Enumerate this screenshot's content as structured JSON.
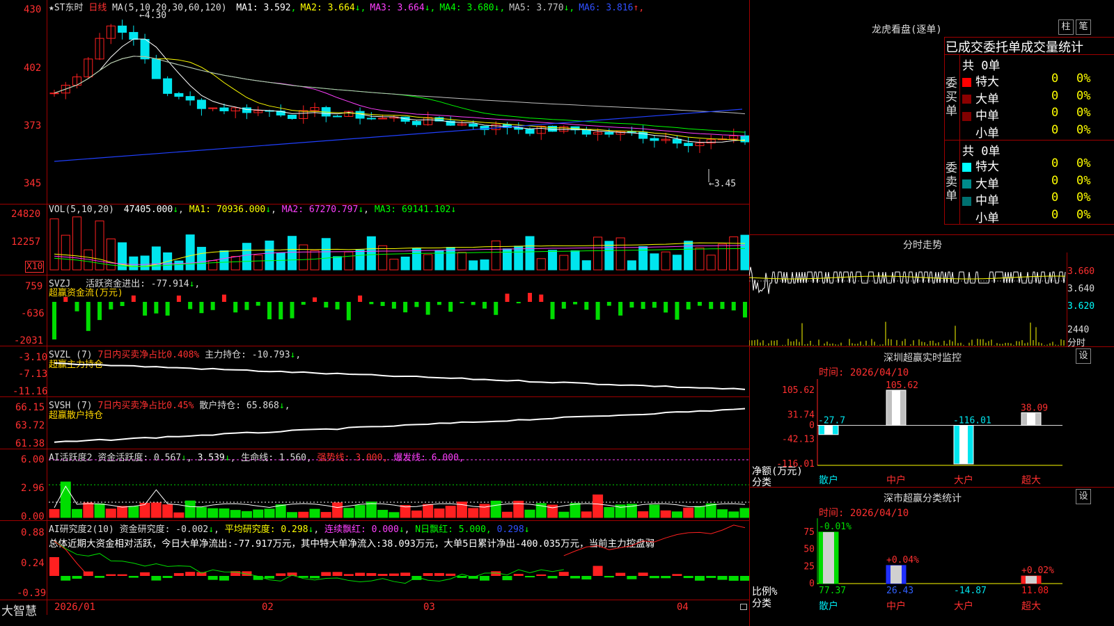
{
  "colors": {
    "up": "#ff2020",
    "down": "#00e5ee",
    "grid": "#a00000",
    "bg": "#000000"
  },
  "kline": {
    "stock_name": "★ST东时",
    "period": "日线",
    "ma_params": "MA(5,10,20,30,60,120)",
    "ma": [
      {
        "label": "MA1:",
        "value": "3.592",
        "arrow": "",
        "color": "#ffffff"
      },
      {
        "label": "MA2:",
        "value": "3.664",
        "arrow": "↓",
        "color": "#ffff00"
      },
      {
        "label": "MA3:",
        "value": "3.664",
        "arrow": "↓",
        "color": "#ff40ff"
      },
      {
        "label": "MA4:",
        "value": "3.680",
        "arrow": "↓",
        "color": "#00ff00"
      },
      {
        "label": "MA5:",
        "value": "3.770",
        "arrow": "↓",
        "color": "#c0c0c0"
      },
      {
        "label": "MA6:",
        "value": "3.816",
        "arrow": "↑",
        "color": "#3050ff"
      }
    ],
    "axis": [
      "430",
      "402",
      "373",
      "345"
    ],
    "high_mark": "4.30",
    "low_mark": "3.45"
  },
  "vol": {
    "title": "VOL(5,10,20)",
    "value": "47405.000",
    "arrow": "↓",
    "ma1": "MA1: 70936.000",
    "ma1_arrow": "↓",
    "ma2": "MA2: 67270.797",
    "ma2_arrow": "↓",
    "ma3": "MA3: 69141.102",
    "ma3_arrow": "↓",
    "axis": [
      "24820",
      "12257"
    ],
    "unit": "X10"
  },
  "svzj": {
    "title": "SVZJ",
    "label": "活跃资金进出: -77.914",
    "arrow": "↓",
    "sub": "超赢资金流(万元)",
    "axis": [
      "759",
      "-636",
      "-2031"
    ]
  },
  "svzl": {
    "title": "SVZL (7)",
    "red": "7日内买卖净占比0.408%",
    "label": "主力持仓: -10.793",
    "arrow": "↓",
    "sub": "超赢主力持仓",
    "axis": [
      "-3.10",
      "-7.13",
      "-11.16"
    ]
  },
  "svsh": {
    "title": "SVSH (7)",
    "red": "7日内买卖净占比0.45%",
    "label": "散户持仓: 65.868",
    "arrow": "↓",
    "sub": "超赢散户持仓",
    "axis": [
      "66.15",
      "63.72",
      "61.38"
    ]
  },
  "ai1": {
    "title": "AI活跃度2",
    "label": "资金活跃度: 0.567",
    "arrow": "↓",
    "v2": "3.539",
    "a2": "↓",
    "v3": "生命线: 1.560,",
    "qs": "强势线: 3.000,",
    "bf": "爆发线: 6.000,",
    "axis": [
      "6.00",
      "2.96",
      "0.00"
    ]
  },
  "ai2": {
    "title": "AI研究度2(10)",
    "label": "资金研究度: -0.002",
    "arrow": "↓",
    "p": "平均研究度: 0.298",
    "pa": "↓",
    "lx": "连续飘红: 0.000",
    "la": "↓",
    "n": "N日飘红: 5.000,",
    "n2": "0.298",
    "na": "↓",
    "desc": "总体近期大资金相对活跃，今日大单净流出:-77.917万元，其中特大单净流入:38.093万元，大单5日累计净出-400.035万元，当前主力控盘弱",
    "axis": [
      "0.88",
      "0.24",
      "-0.39"
    ]
  },
  "xaxis": [
    "2026/01",
    "02",
    "03",
    "04"
  ],
  "brand": "大智慧",
  "lhb": {
    "title": "龙虎看盘(逐单)",
    "btn1": "柱",
    "btn2": "笔",
    "subtitle": "已成交委托单成交量统计",
    "buy": {
      "side": "委买单",
      "total": "共 0单",
      "rows": [
        {
          "name": "特大",
          "count": "0",
          "pct": "0%",
          "color": "#ff0000"
        },
        {
          "name": "大单",
          "count": "0",
          "pct": "0%",
          "color": "#8b0000"
        },
        {
          "name": "中单",
          "count": "0",
          "pct": "0%",
          "color": "#800000"
        },
        {
          "name": "小单",
          "count": "0",
          "pct": "0%",
          "color": ""
        }
      ]
    },
    "sell": {
      "side": "委卖单",
      "total": "共 0单",
      "rows": [
        {
          "name": "特大",
          "count": "0",
          "pct": "0%",
          "color": "#00ffff"
        },
        {
          "name": "大单",
          "count": "0",
          "pct": "0%",
          "color": "#008b8b"
        },
        {
          "name": "中单",
          "count": "0",
          "pct": "0%",
          "color": "#007070"
        },
        {
          "name": "小单",
          "count": "0",
          "pct": "0%",
          "color": ""
        }
      ]
    }
  },
  "fs": {
    "title": "分时走势",
    "axis": [
      "3.660",
      "3.640",
      "3.620"
    ],
    "vol_axis": "2440",
    "unit": "分时"
  },
  "monitor": {
    "title": "深圳超赢实时监控",
    "btn": "设",
    "time": "时间: 2026/04/10",
    "axis": [
      "105.62",
      "31.74",
      "0",
      "-42.13",
      "-116.01"
    ],
    "ylabel": "净额(万元)",
    "xlabel": "分类",
    "cats": [
      "散户",
      "中户",
      "大户",
      "超大"
    ],
    "vals": [
      "-27.7",
      "105.62",
      "-116.01",
      "38.09"
    ]
  },
  "stat": {
    "title": "深市超赢分类统计",
    "btn": "设",
    "time": "时间: 2026/04/10",
    "axis": [
      "75",
      "50",
      "25",
      "0"
    ],
    "ylabel": "比例%",
    "xlabel": "分类",
    "cats": [
      "散户",
      "中户",
      "大户",
      "超大"
    ],
    "top": [
      "-0.01%",
      "+0.04%",
      "",
      "+0.02%"
    ],
    "bottom": [
      "77.37",
      "26.43",
      "-14.87",
      "11.08"
    ]
  },
  "chart_data": [
    {
      "type": "monitor-bar",
      "categories": [
        "散户",
        "中户",
        "大户",
        "超大"
      ],
      "values": [
        -27.7,
        105.62,
        -116.01,
        38.09
      ],
      "ylim": [
        -116.01,
        105.62
      ]
    },
    {
      "type": "stat-bar",
      "categories": [
        "散户",
        "中户",
        "大户",
        "超大"
      ],
      "values": [
        77.37,
        26.43,
        -14.87,
        11.08
      ],
      "ylim": [
        0,
        75
      ]
    }
  ]
}
